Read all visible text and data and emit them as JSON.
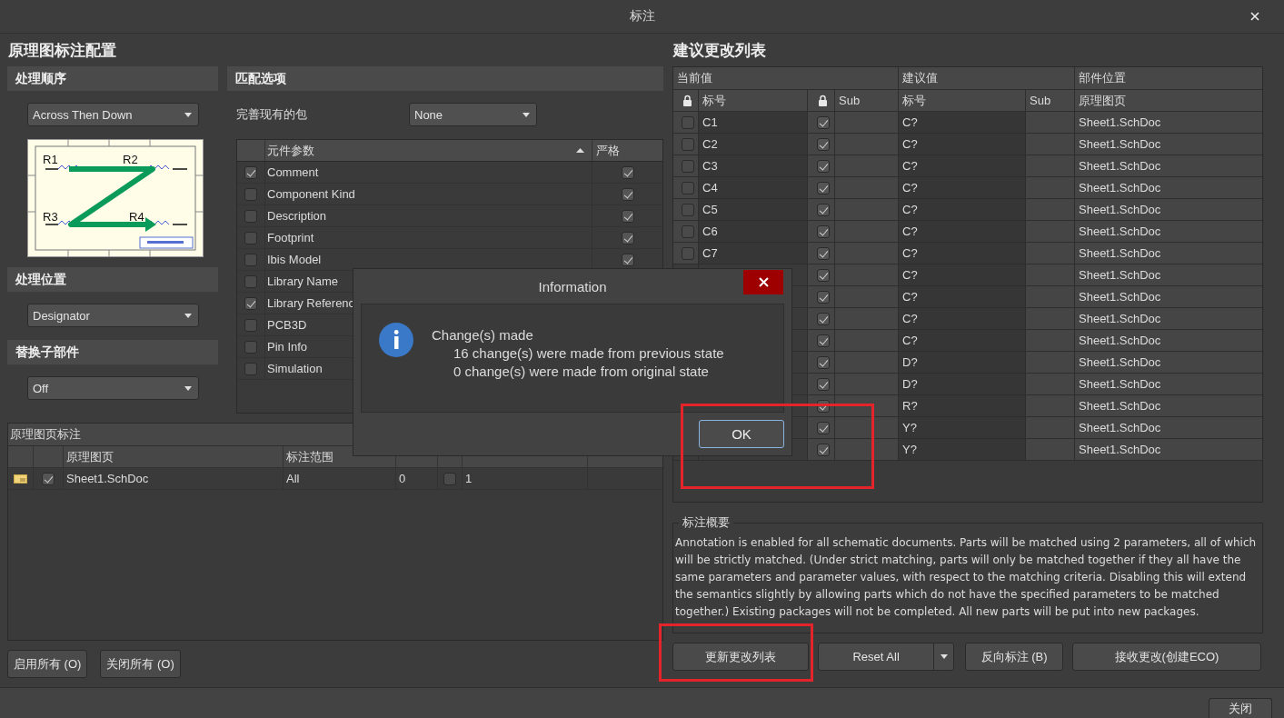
{
  "window": {
    "title": "标注"
  },
  "left_panel": {
    "title": "原理图标注配置",
    "order": {
      "header": "处理顺序",
      "dropdown": "Across Then Down",
      "preview_labels": [
        "R1",
        "R2",
        "R3",
        "R4"
      ]
    },
    "location": {
      "header": "处理位置",
      "dropdown": "Designator"
    },
    "subparts": {
      "header": "替换子部件",
      "dropdown": "Off"
    },
    "matching": {
      "header": "匹配选项",
      "complete_label": "完善现有的包",
      "complete_dropdown": "None",
      "columns": [
        "元件参数",
        "严格"
      ],
      "params": [
        {
          "name": "Comment",
          "checked": true,
          "strict": true
        },
        {
          "name": "Component Kind",
          "checked": false,
          "strict": true
        },
        {
          "name": "Description",
          "checked": false,
          "strict": true
        },
        {
          "name": "Footprint",
          "checked": false,
          "strict": true
        },
        {
          "name": "Ibis Model",
          "checked": false,
          "strict": true
        },
        {
          "name": "Library Name",
          "checked": false
        },
        {
          "name": "Library Referenc",
          "checked": true
        },
        {
          "name": "PCB3D",
          "checked": false
        },
        {
          "name": "Pin Info",
          "checked": false
        },
        {
          "name": "Simulation",
          "checked": false
        }
      ]
    },
    "sheets": {
      "title": "原理图页标注",
      "columns": [
        "原理图页",
        "标注范围"
      ],
      "rows": [
        {
          "enabled": true,
          "sheet": "Sheet1.SchDoc",
          "scope": "All",
          "order": "0",
          "start_checked": false,
          "start_index": "1"
        }
      ]
    },
    "buttons": [
      "启用所有 (O)",
      "关闭所有 (O)"
    ]
  },
  "changes": {
    "title": "建议更改列表",
    "groups": [
      "当前值",
      "建议值",
      "部件位置"
    ],
    "columns": [
      "标号",
      "Sub",
      "标号",
      "Sub",
      "原理图页"
    ],
    "rows": [
      {
        "current": "C1",
        "locked": false,
        "sub_locked": true,
        "proposed": "C?",
        "sheet": "Sheet1.SchDoc"
      },
      {
        "current": "C2",
        "locked": false,
        "sub_locked": true,
        "proposed": "C?",
        "sheet": "Sheet1.SchDoc"
      },
      {
        "current": "C3",
        "locked": false,
        "sub_locked": true,
        "proposed": "C?",
        "sheet": "Sheet1.SchDoc"
      },
      {
        "current": "C4",
        "locked": false,
        "sub_locked": true,
        "proposed": "C?",
        "sheet": "Sheet1.SchDoc"
      },
      {
        "current": "C5",
        "locked": false,
        "sub_locked": true,
        "proposed": "C?",
        "sheet": "Sheet1.SchDoc"
      },
      {
        "current": "C6",
        "locked": false,
        "sub_locked": true,
        "proposed": "C?",
        "sheet": "Sheet1.SchDoc"
      },
      {
        "current": "C7",
        "locked": false,
        "sub_locked": true,
        "proposed": "C?",
        "sheet": "Sheet1.SchDoc"
      },
      {
        "sub_locked": true,
        "proposed": "C?",
        "sheet": "Sheet1.SchDoc"
      },
      {
        "sub_locked": true,
        "proposed": "C?",
        "sheet": "Sheet1.SchDoc"
      },
      {
        "sub_locked": true,
        "proposed": "C?",
        "sheet": "Sheet1.SchDoc"
      },
      {
        "sub_locked": true,
        "proposed": "C?",
        "sheet": "Sheet1.SchDoc"
      },
      {
        "sub_locked": true,
        "proposed": "D?",
        "sheet": "Sheet1.SchDoc"
      },
      {
        "sub_locked": true,
        "proposed": "D?",
        "sheet": "Sheet1.SchDoc"
      },
      {
        "sub_locked": true,
        "proposed": "R?",
        "sheet": "Sheet1.SchDoc"
      },
      {
        "sub_locked": true,
        "proposed": "Y?",
        "sheet": "Sheet1.SchDoc"
      },
      {
        "sub_locked": true,
        "proposed": "Y?",
        "sheet": "Sheet1.SchDoc"
      }
    ],
    "summary": {
      "title": "标注概要",
      "text": "Annotation is enabled for all schematic documents. Parts will be matched using 2 parameters, all of which will be strictly matched. (Under strict matching, parts will only be matched together if they all have the same parameters and parameter values, with respect to the matching criteria. Disabling this will extend the semantics slightly by allowing parts which do not have the specified parameters to be matched together.) Existing packages will not be completed. All new parts will be put into new packages."
    },
    "buttons": [
      {
        "label": "更新更改列表",
        "kind": "plain",
        "highlighted": true
      },
      {
        "label": "Reset All",
        "kind": "split",
        "highlighted": false
      },
      {
        "label": "反向标注 (B)",
        "kind": "plain",
        "highlighted": false
      },
      {
        "label": "接收更改(创建ECO)",
        "kind": "plain",
        "highlighted": false
      }
    ]
  },
  "footer_button": "关闭",
  "info_dialog": {
    "title": "Information",
    "heading": "Change(s) made",
    "lines": [
      "16 change(s) were made from previous state",
      "0 change(s) were made from original state"
    ],
    "ok": {
      "label": "OK",
      "highlighted": true
    }
  }
}
